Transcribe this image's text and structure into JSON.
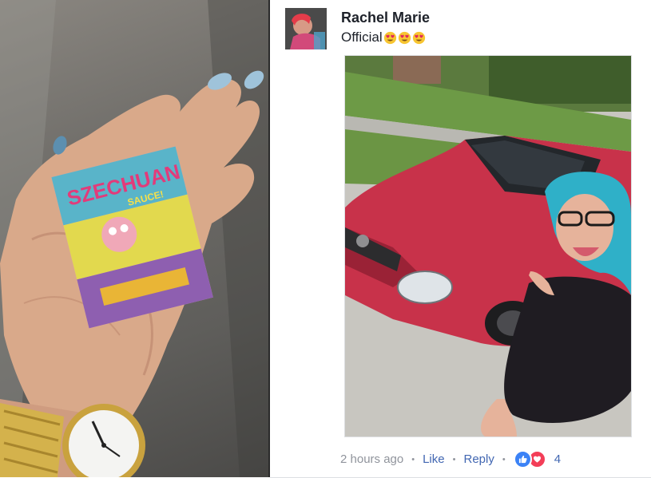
{
  "comment": {
    "author": "Rachel Marie",
    "text": "Official",
    "emoji_count": 3,
    "emoji_icon": "heart-eyes-emoji-icon",
    "timestamp": "2 hours ago",
    "like_label": "Like",
    "reply_label": "Reply",
    "reaction_count": "4",
    "reaction_icons": [
      "like-reaction-icon",
      "love-reaction-icon"
    ]
  },
  "left_card": {
    "title": "SZECHUAN",
    "subtitle": "SAUCE!"
  },
  "colors": {
    "link_blue": "#4267b2",
    "meta_gray": "#90949c",
    "like_blue": "#3b82f6",
    "love_red": "#f33e58",
    "car_red": "#c8324a",
    "hair_teal": "#2fb0c8"
  }
}
